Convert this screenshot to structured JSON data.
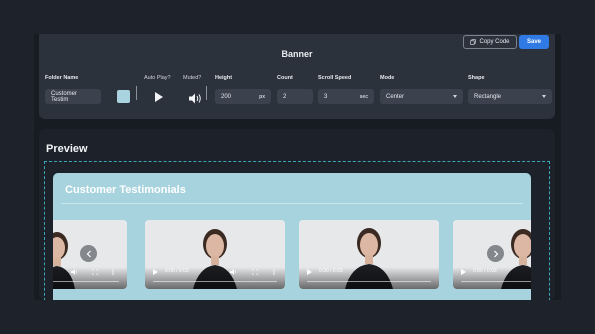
{
  "header": {
    "title": "Banner",
    "copy_code_label": "Copy Code",
    "save_label": "Save"
  },
  "settings": {
    "folder_name": {
      "label": "Folder Name",
      "value": "Customer Testim"
    },
    "auto_play": {
      "label": "Auto Play?",
      "icon": "play-icon"
    },
    "muted": {
      "label": "Muted?",
      "icon": "volume-icon"
    },
    "height": {
      "label": "Height",
      "value": "200",
      "unit": "px"
    },
    "count": {
      "label": "Count",
      "value": "2"
    },
    "scroll_speed": {
      "label": "Scroll Speed",
      "value": "3",
      "unit": "sec"
    },
    "mode": {
      "label": "Mode",
      "value": "Center"
    },
    "shape": {
      "label": "Shape",
      "value": "Rectangle"
    },
    "swatch_color": "#a8d3df"
  },
  "preview": {
    "title": "Preview",
    "banner_title": "Customer Testimonials",
    "banner_color": "#a7d3de",
    "videos": [
      {
        "time": ""
      },
      {
        "time": "0:00 / 0:03"
      },
      {
        "time": "0:00 / 0:03"
      },
      {
        "time": "0:00 / 0:03"
      }
    ]
  },
  "colors": {
    "accent": "#2f7ae5",
    "dashed_border": "#3aa7b8"
  }
}
